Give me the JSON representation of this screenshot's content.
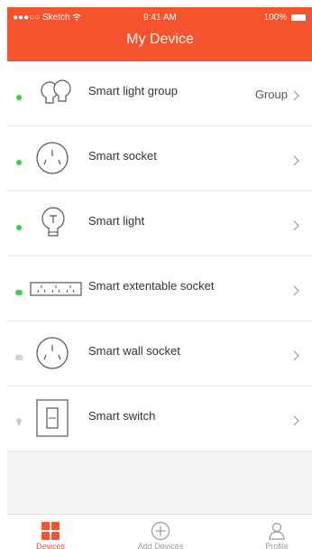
{
  "status_bar": {
    "carrier": "●●●○○ Sketch",
    "wifi_icon": "wifi-icon",
    "time": "9:41 AM",
    "battery": "100%"
  },
  "header": {
    "title": "My Device",
    "color": "#f5532d"
  },
  "devices": [
    {
      "name": "Smart light group",
      "detail": "Group",
      "icon": "light-group-icon",
      "status": "online"
    },
    {
      "name": "Smart socket",
      "detail": "",
      "icon": "socket-icon",
      "status": "online"
    },
    {
      "name": "Smart light",
      "detail": "",
      "icon": "bulb-icon",
      "status": "online"
    },
    {
      "name": "Smart extentable socket",
      "detail": "",
      "icon": "power-strip-icon",
      "status": "online"
    },
    {
      "name": "Smart wall socket",
      "detail": "",
      "icon": "wall-socket-icon",
      "status": "offline"
    },
    {
      "name": "Smart switch",
      "detail": "",
      "icon": "switch-icon",
      "status": "offline"
    }
  ],
  "tabs": [
    {
      "label": "Devices",
      "icon": "grid-icon",
      "active": true
    },
    {
      "label": "Add Devices",
      "icon": "plus-circle-icon",
      "active": false
    },
    {
      "label": "Profile",
      "icon": "person-icon",
      "active": false
    }
  ],
  "colors": {
    "accent": "#f5532d",
    "online": "#3ad24d",
    "offline": "#d4d4d4",
    "tab_inactive": "#999999"
  }
}
